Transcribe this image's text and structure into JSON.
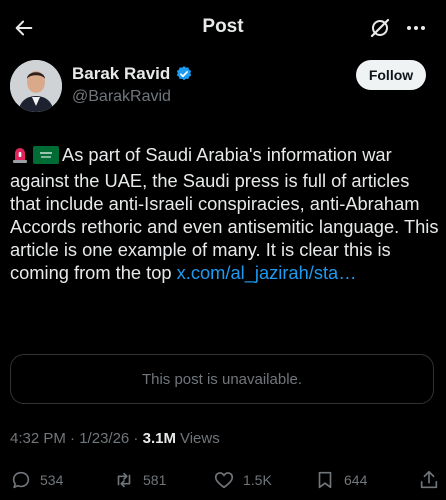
{
  "header": {
    "title": "Post"
  },
  "author": {
    "name": "Barak Ravid",
    "handle": "@BarakRavid"
  },
  "follow_label": "Follow",
  "post": {
    "text": "As part of Saudi Arabia's information war against the UAE, the Saudi press is full of articles that include anti-Israeli conspiracies, anti-Abraham Accords rethoric and even antisemitic language. This article is one example of many. It is clear this is coming from the top",
    "link": "x.com/al_jazirah/sta…"
  },
  "quote": {
    "unavailable_text": "This post is unavailable."
  },
  "meta": {
    "time": "4:32 PM",
    "date": "1/23/26",
    "views_count": "3.1M",
    "views_label": "Views"
  },
  "actions": {
    "replies": "534",
    "reposts": "581",
    "likes": "1.5K",
    "bookmarks": "644"
  },
  "icons": {
    "back": "arrow-left-icon",
    "grok": "grok-icon",
    "more": "more-icon",
    "verified": "verified-badge-icon",
    "siren": "siren-emoji",
    "flag": "saudi-flag-emoji",
    "reply": "reply-icon",
    "repost": "repost-icon",
    "like": "heart-icon",
    "bookmark": "bookmark-icon",
    "share": "share-icon"
  },
  "colors": {
    "background": "#000000",
    "text": "#e7e9ea",
    "muted": "#71767b",
    "link": "#1d9bf0",
    "verified": "#1d9bf0",
    "follow_bg": "#eff3f4"
  }
}
